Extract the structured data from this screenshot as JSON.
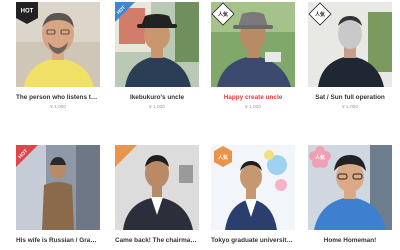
{
  "colors": {
    "card_title": "#333333",
    "card_title_highlight": "#e03b3b",
    "price": "#9a9a9a",
    "badge_black": "#222222",
    "badge_white": "#ffffff",
    "badge_blue": "#3a87d6",
    "badge_red": "#e2434b",
    "badge_orange": "#e9944a",
    "badge_pink": "#f0a0b4"
  },
  "cards": [
    {
      "title": "The person who listens to a ...",
      "price": "¥ 1,000",
      "badge": "HOT",
      "badge_style": "black-square",
      "highlight": false
    },
    {
      "title": "Ikebukuro's uncle",
      "price": "¥ 1,000",
      "badge": "HOT",
      "badge_style": "blue-ribbon",
      "highlight": false
    },
    {
      "title": "Happy create uncle",
      "price": "¥ 1,000",
      "badge": "人気",
      "badge_style": "white-diamond",
      "highlight": true
    },
    {
      "title": "Sat / Sun full operation",
      "price": "¥ 1,000",
      "badge": "人気",
      "badge_style": "white-diamond",
      "highlight": false
    },
    {
      "title": "His wife is Russian / Gradua...",
      "price": "",
      "badge": "HOT",
      "badge_style": "red-ribbon",
      "highlight": false
    },
    {
      "title": "Came back! The chairman is...",
      "price": "",
      "badge": "",
      "badge_style": "orange-ribbon",
      "highlight": false
    },
    {
      "title": "Tokyo graduate university si...",
      "price": "",
      "badge": "人気",
      "badge_style": "orange-hexagon",
      "highlight": false
    },
    {
      "title": "Home Homeman!",
      "price": "",
      "badge": "人気",
      "badge_style": "pink-flower",
      "highlight": false
    }
  ]
}
